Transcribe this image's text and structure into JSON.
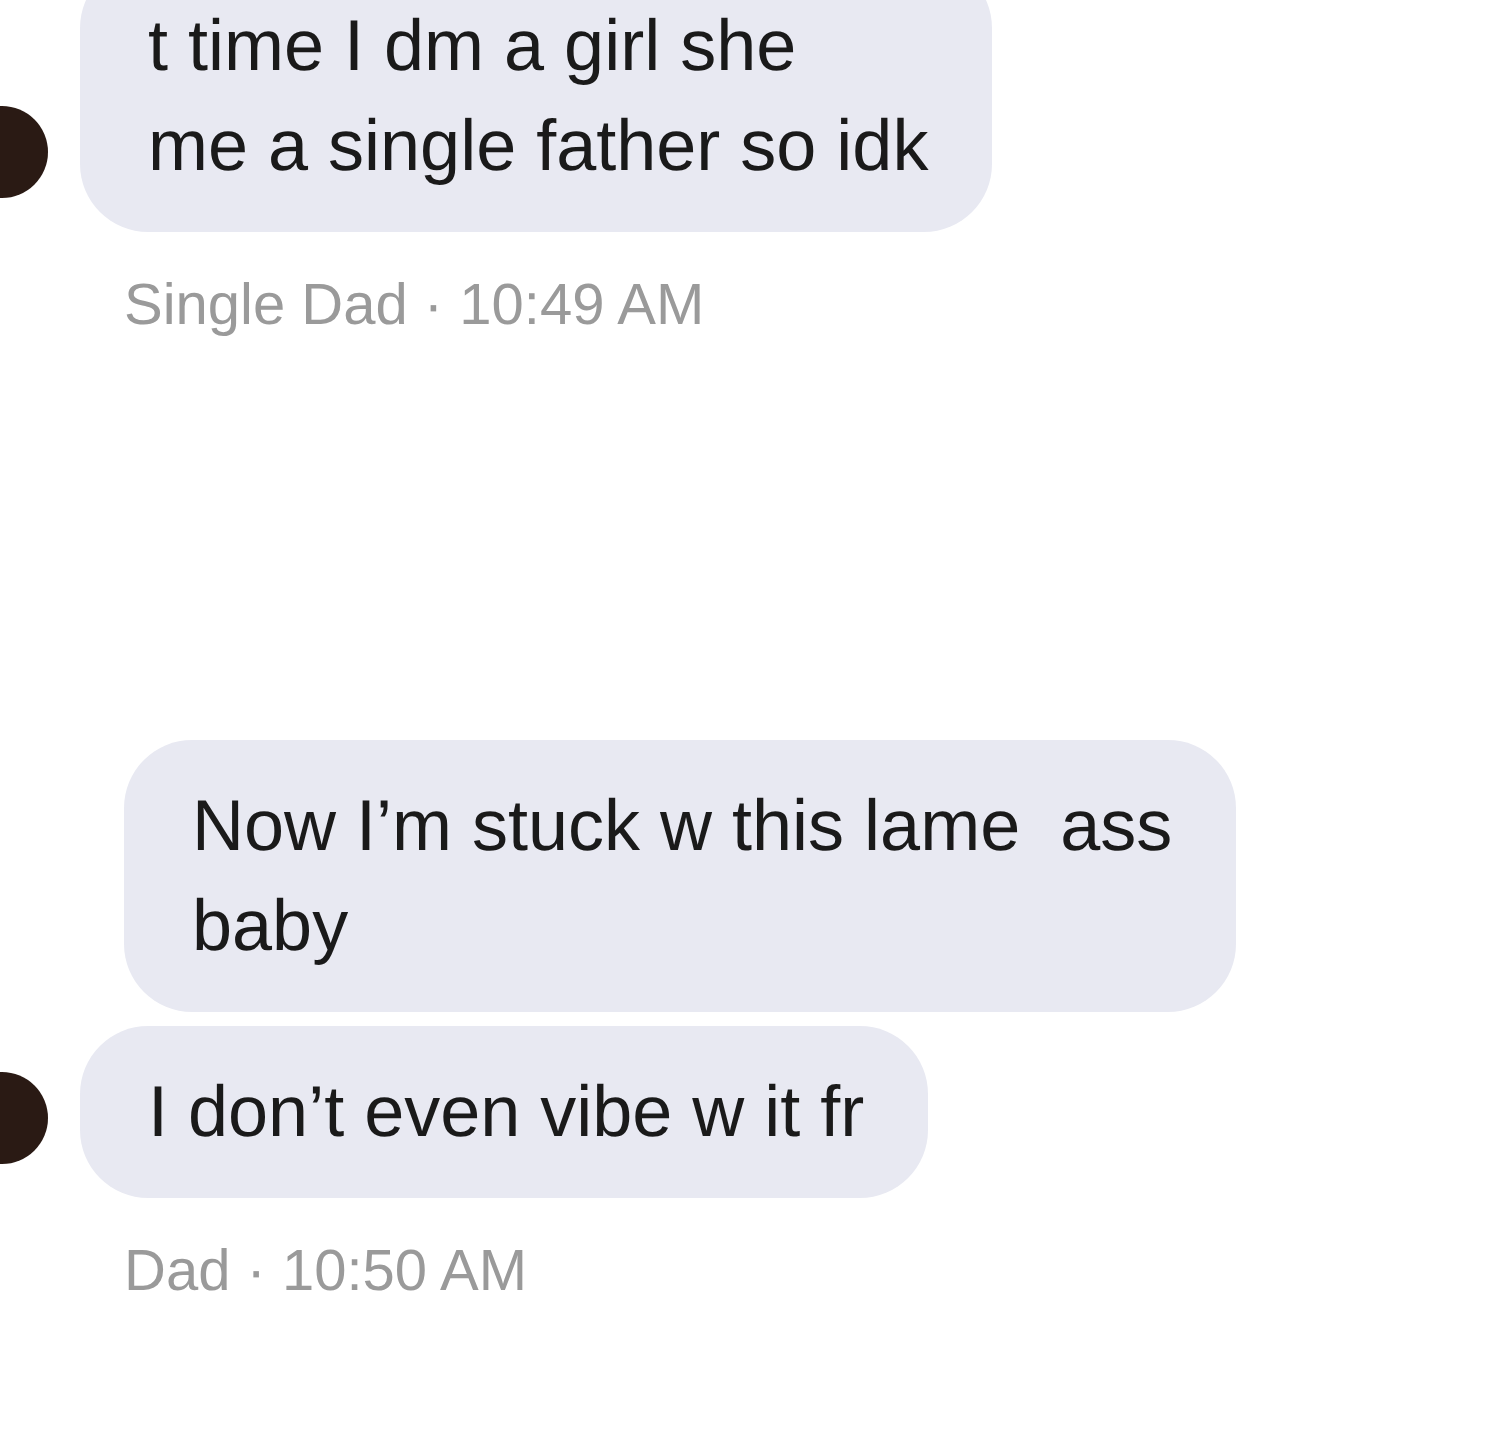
{
  "messages": [
    {
      "kind": "bubble",
      "avatar": true,
      "text": "t time I dm a girl she\nme a single father so idk"
    },
    {
      "kind": "meta",
      "text": "Single Dad · 10:49 AM"
    },
    {
      "kind": "gap"
    },
    {
      "kind": "bubble",
      "avatar": false,
      "text": "Now I’m stuck w this lame  ass\nbaby"
    },
    {
      "kind": "bubble",
      "avatar": true,
      "text": "I don’t even vibe w it fr"
    },
    {
      "kind": "meta",
      "text": "Dad · 10:50 AM"
    }
  ]
}
